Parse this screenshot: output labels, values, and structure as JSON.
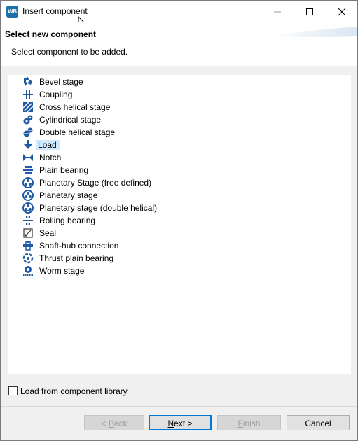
{
  "window": {
    "app_icon_text": "WB",
    "title": "Insert component"
  },
  "header": {
    "title": "Select new component",
    "subtitle": "Select component to be added."
  },
  "components": [
    {
      "label": "Bevel stage",
      "icon": "bevel-stage-icon"
    },
    {
      "label": "Coupling",
      "icon": "coupling-icon"
    },
    {
      "label": "Cross helical stage",
      "icon": "cross-helical-stage-icon"
    },
    {
      "label": "Cylindrical stage",
      "icon": "cylindrical-stage-icon"
    },
    {
      "label": "Double helical stage",
      "icon": "double-helical-stage-icon"
    },
    {
      "label": "Load",
      "icon": "load-arrow-icon",
      "selected": true
    },
    {
      "label": "Notch",
      "icon": "notch-icon"
    },
    {
      "label": "Plain bearing",
      "icon": "plain-bearing-icon"
    },
    {
      "label": "Planetary Stage (free defined)",
      "icon": "planetary-stage-icon"
    },
    {
      "label": "Planetary stage",
      "icon": "planetary-stage-icon"
    },
    {
      "label": "Planetary stage (double helical)",
      "icon": "planetary-stage-double-helical-icon"
    },
    {
      "label": "Rolling bearing",
      "icon": "rolling-bearing-icon"
    },
    {
      "label": "Seal",
      "icon": "seal-icon"
    },
    {
      "label": "Shaft-hub connection",
      "icon": "shaft-hub-connection-icon"
    },
    {
      "label": "Thrust plain bearing",
      "icon": "thrust-plain-bearing-icon"
    },
    {
      "label": "Worm stage",
      "icon": "worm-stage-icon"
    }
  ],
  "library_checkbox": {
    "label": "Load from component library",
    "checked": false
  },
  "buttons": {
    "back": {
      "prefix": "< ",
      "mnemonic": "B",
      "rest": "ack",
      "enabled": false
    },
    "next": {
      "mnemonic": "N",
      "rest": "ext >",
      "enabled": true
    },
    "finish": {
      "mnemonic": "F",
      "rest": "inish",
      "enabled": false
    },
    "cancel": {
      "label": "Cancel",
      "enabled": true
    }
  },
  "colors": {
    "icon_blue": "#1f5aa6",
    "selection": "#cde8ff",
    "default_button_border": "#0078d7"
  }
}
